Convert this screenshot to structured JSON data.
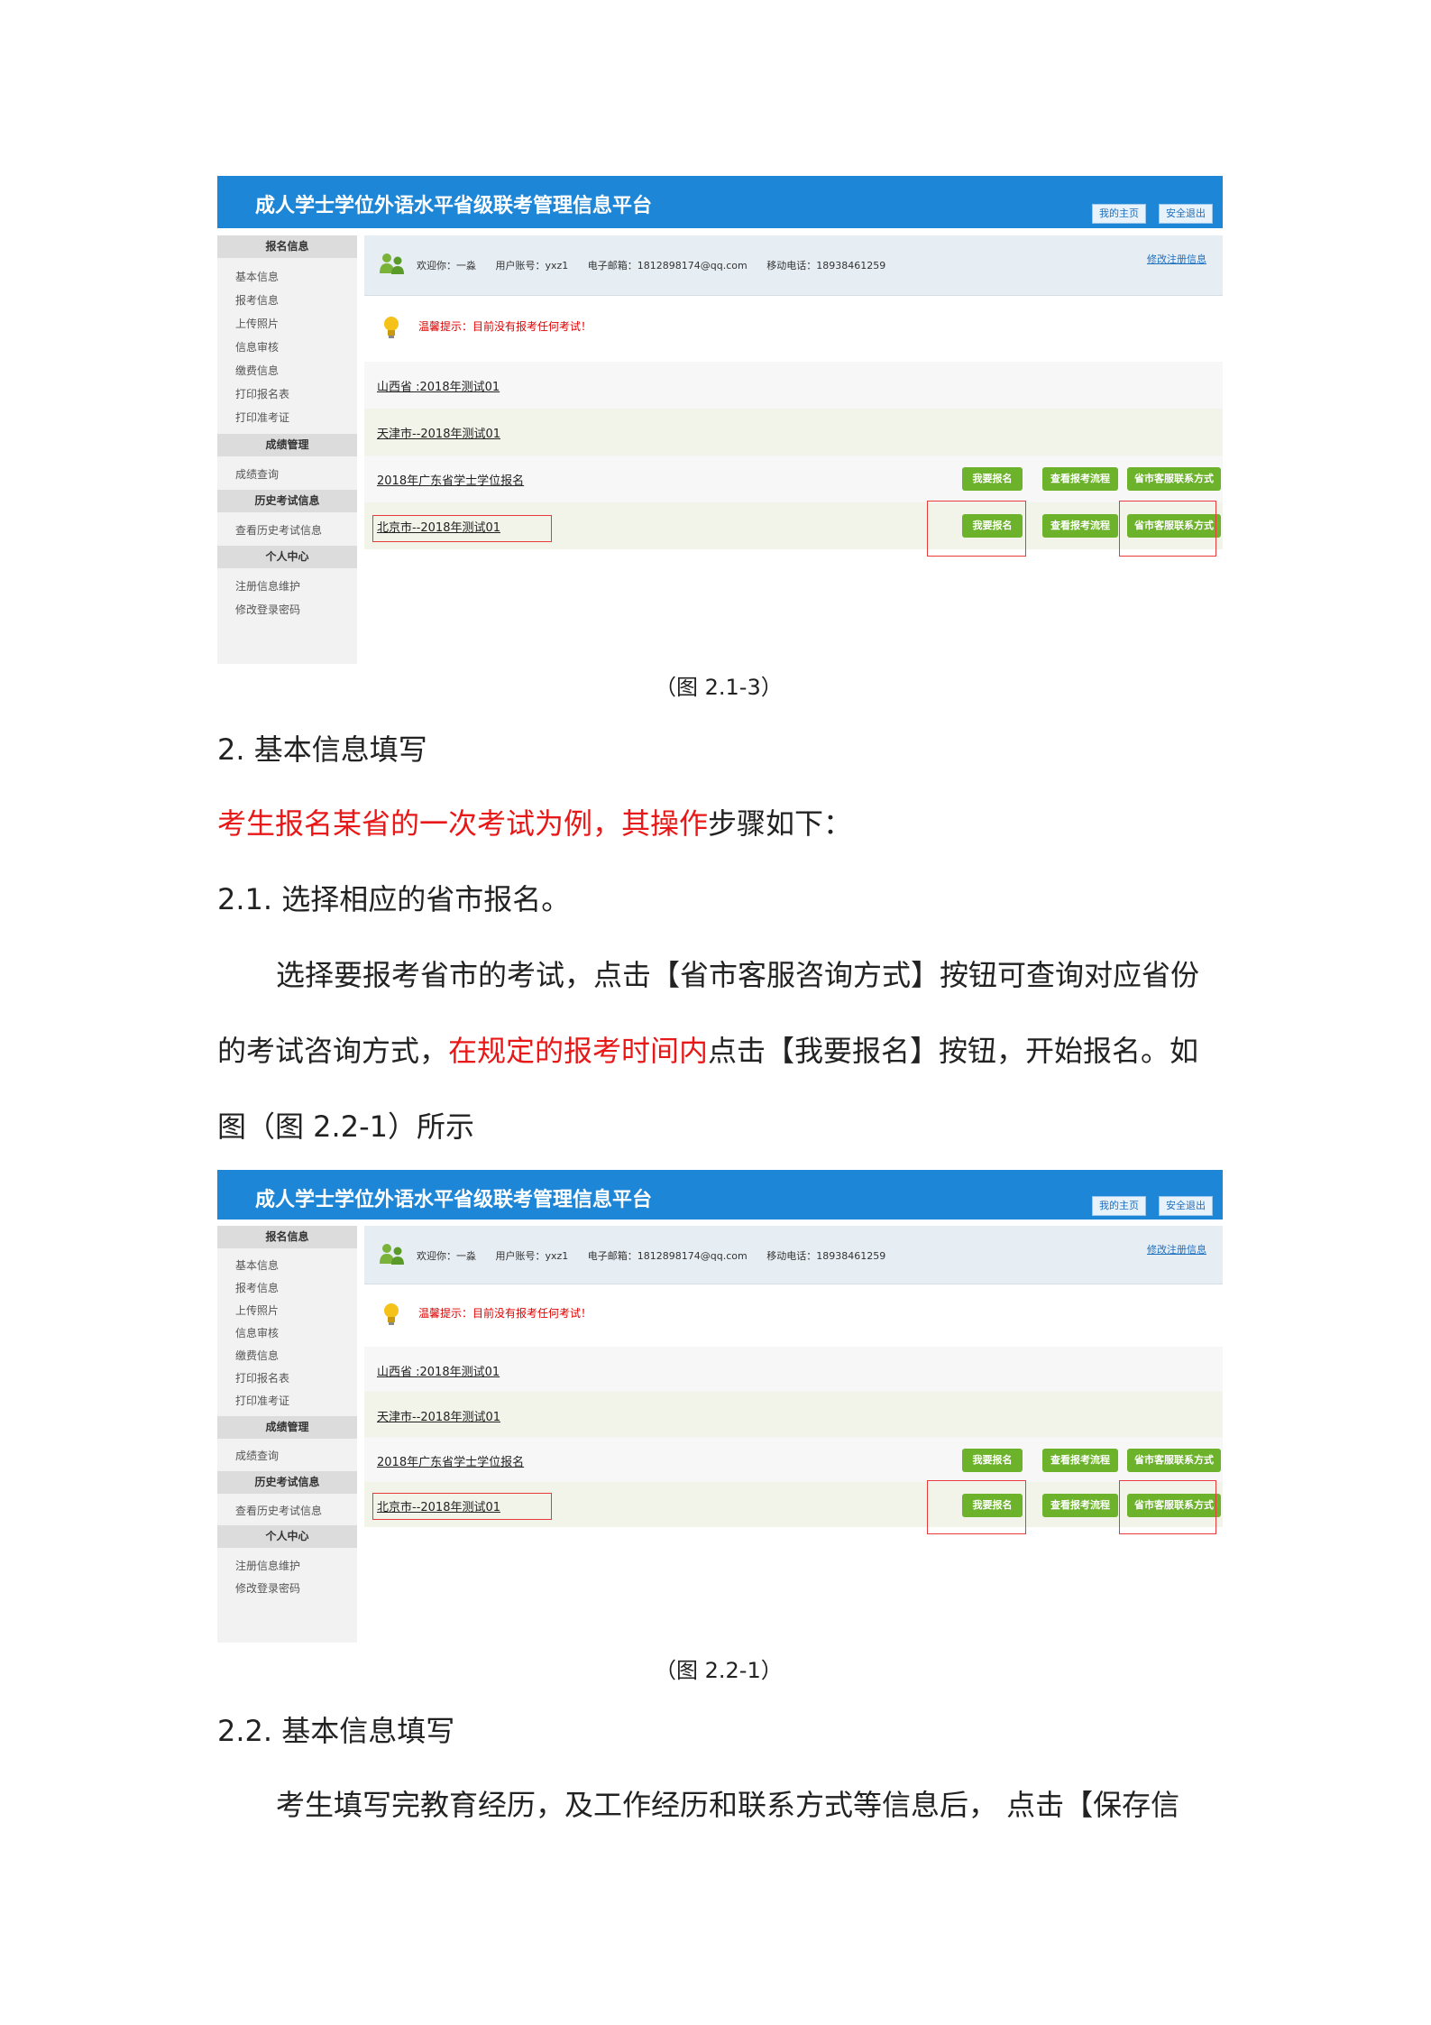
{
  "app": {
    "title": "成人学士学位外语水平省级联考管理信息平台",
    "home_button": "我的主页",
    "logout_button": "安全退出"
  },
  "sidebar": {
    "sections": [
      {
        "label": "报名信息",
        "items": [
          "基本信息",
          "报考信息",
          "上传照片",
          "信息审核",
          "缴费信息",
          "打印报名表",
          "打印准考证"
        ]
      },
      {
        "label": "成绩管理",
        "items": [
          "成绩查询"
        ]
      },
      {
        "label": "历史考试信息",
        "items": [
          "查看历史考试信息"
        ]
      },
      {
        "label": "个人中心",
        "items": [
          "注册信息维护",
          "修改登录密码"
        ]
      }
    ]
  },
  "user": {
    "welcome": "欢迎你：一淼",
    "account": "用户账号：yxz1",
    "email": "电子邮箱：1812898174@qq.com",
    "phone": "移动电话：18938461259",
    "edit_link": "修改注册信息"
  },
  "tip": "温馨提示：目前没有报考任何考试！",
  "exams": [
    {
      "name": "山西省 :2018年测试01",
      "buttons": false
    },
    {
      "name": "天津市--2018年测试01",
      "buttons": false
    },
    {
      "name": "2018年广东省学士学位报名",
      "buttons": true
    },
    {
      "name": "北京市--2018年测试01",
      "buttons": true
    }
  ],
  "buttons": {
    "apply": "我要报名",
    "process": "查看报考流程",
    "contact": "省市客服联系方式"
  },
  "document": {
    "caption1": "（图 2.1-3）",
    "heading2": "2. 基本信息填写",
    "intro_red": "考生报名某省的一次考试为例，其操作",
    "intro_black": "步骤如下：",
    "heading21": "2.1. 选择相应的省市报名。",
    "para1_line1": "选择要报考省市的考试，点击【省市客服咨询方式】按钮可查询对应省份",
    "para1_line2_a": "的考试咨询方式，",
    "para1_line2_red": "在规定的报考时间内",
    "para1_line2_b": "点击【我要报名】按钮，开始报名。如",
    "para1_line3": "图（图 2.2-1）所示",
    "caption2": "（图 2.2-1）",
    "heading22": "2.2. 基本信息填写",
    "para2_line1": "考生填写完教育经历，及工作经历和联系方式等信息后， 点击【保存信"
  }
}
